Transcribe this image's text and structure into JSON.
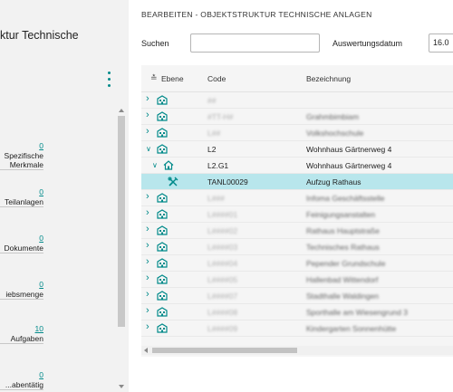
{
  "factbox": {
    "title": "ktur Technische",
    "stats": [
      {
        "value": "0",
        "label": "Spezifische Merkmale",
        "label1": "Spezifische",
        "label2": "Merkmale"
      },
      {
        "value": "0",
        "label": "Teilanlagen"
      },
      {
        "value": "0",
        "label": "Dokumente"
      },
      {
        "value": "0",
        "label": "iebsmenge"
      },
      {
        "value": "10",
        "label": "Aufgaben"
      },
      {
        "value": "0",
        "label": "abentätig..."
      }
    ]
  },
  "page": {
    "caption": "BEARBEITEN - OBJEKTSTRUKTUR TECHNISCHE ANLAGEN",
    "search_label": "Suchen",
    "search_value": "",
    "date_label": "Auswertungsdatum",
    "date_value": "16.0"
  },
  "grid": {
    "columns": {
      "ebene": "Ebene",
      "code": "Code",
      "bezeichnung": "Bezeichnung"
    },
    "rows": [
      {
        "expander": ">",
        "icon": "building-icon",
        "code": "",
        "desc": "",
        "obscured": true
      },
      {
        "expander": ">",
        "icon": "building-icon",
        "code": "",
        "desc": "",
        "obscured": true
      },
      {
        "expander": ">",
        "icon": "building-icon",
        "code": "",
        "desc": "",
        "obscured": true
      },
      {
        "expander": "v",
        "icon": "building-icon",
        "code": "L2",
        "desc": "Wohnhaus Gärtnerweg 4",
        "obscured": false
      },
      {
        "expander": "v",
        "icon": "house-icon",
        "code": "L2.G1",
        "desc": "Wohnhaus Gärtnerweg 4",
        "obscured": false
      },
      {
        "expander": "",
        "icon": "tools-icon",
        "code": "TANL00029",
        "desc": "Aufzug Rathaus",
        "obscured": false,
        "selected": true
      },
      {
        "expander": ">",
        "icon": "building-icon",
        "code": "",
        "desc": "",
        "obscured": true
      },
      {
        "expander": ">",
        "icon": "building-icon",
        "code": "",
        "desc": "",
        "obscured": true
      },
      {
        "expander": ">",
        "icon": "building-icon",
        "code": "",
        "desc": "",
        "obscured": true
      },
      {
        "expander": ">",
        "icon": "building-icon",
        "code": "",
        "desc": "",
        "obscured": true
      },
      {
        "expander": ">",
        "icon": "building-icon",
        "code": "",
        "desc": "",
        "obscured": true
      },
      {
        "expander": ">",
        "icon": "building-icon",
        "code": "",
        "desc": "",
        "obscured": true
      },
      {
        "expander": ">",
        "icon": "building-icon",
        "code": "",
        "desc": "",
        "obscured": true
      },
      {
        "expander": ">",
        "icon": "building-icon",
        "code": "",
        "desc": "",
        "obscured": true
      },
      {
        "expander": ">",
        "icon": "building-icon",
        "code": "",
        "desc": "",
        "obscured": true
      }
    ]
  },
  "colors": {
    "accent": "#008a8a",
    "selected_row": "#b8e6ec"
  }
}
